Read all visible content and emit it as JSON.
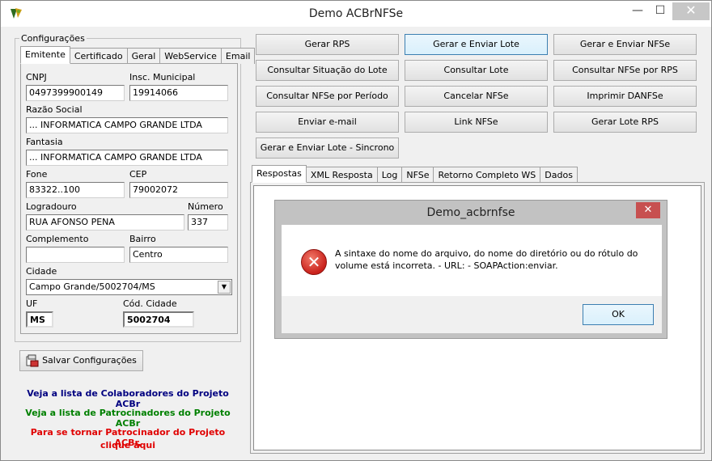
{
  "window": {
    "title": "Demo ACBrNFSe",
    "minimize": "—",
    "maximize": "☐",
    "close": "✕"
  },
  "config": {
    "group_label": "Configurações",
    "tabs": [
      "Emitente",
      "Certificado",
      "Geral",
      "WebService",
      "Email"
    ],
    "fields": {
      "cnpj_label": "CNPJ",
      "cnpj_value": "0497399900149",
      "im_label": "Insc. Municipal",
      "im_value": "19914066",
      "razao_label": "Razão Social",
      "razao_value": "... INFORMATICA CAMPO GRANDE LTDA",
      "fantasia_label": "Fantasia",
      "fantasia_value": "... INFORMATICA CAMPO GRANDE LTDA",
      "fone_label": "Fone",
      "fone_value": "83322..100",
      "cep_label": "CEP",
      "cep_value": "79002072",
      "logradouro_label": "Logradouro",
      "logradouro_value": "RUA AFONSO PENA",
      "numero_label": "Número",
      "numero_value": "337",
      "complemento_label": "Complemento",
      "complemento_value": "",
      "bairro_label": "Bairro",
      "bairro_value": "Centro",
      "cidade_label": "Cidade",
      "cidade_value": "Campo Grande/5002704/MS",
      "uf_label": "UF",
      "uf_value": "MS",
      "codcidade_label": "Cód. Cidade",
      "codcidade_value": "5002704"
    },
    "save_button": "Salvar Configurações"
  },
  "links": {
    "colaboradores": "Veja a lista de Colaboradores do Projeto ACBr",
    "patrocinadores": "Veja a lista de Patrocinadores do Projeto ACBr",
    "patrocinador_1": "Para se tornar Patrocinador do Projeto ACBr,",
    "patrocinador_2": "clique aqui"
  },
  "actions": {
    "gerar_rps": "Gerar RPS",
    "gerar_enviar_lote": "Gerar e Enviar Lote",
    "gerar_enviar_nfse": "Gerar e Enviar NFSe",
    "consultar_situacao": "Consultar Situação do Lote",
    "consultar_lote": "Consultar Lote",
    "consultar_nfse_rps": "Consultar NFSe por RPS",
    "consultar_nfse_periodo": "Consultar NFSe por Período",
    "cancelar_nfse": "Cancelar NFSe",
    "imprimir_danfse": "Imprimir DANFSe",
    "enviar_email": "Enviar e-mail",
    "link_nfse": "Link NFSe",
    "gerar_lote_rps": "Gerar Lote RPS",
    "gerar_enviar_sincrono": "Gerar e Enviar Lote - Sincrono"
  },
  "result_tabs": [
    "Respostas",
    "XML Resposta",
    "Log",
    "NFSe",
    "Retorno Completo WS",
    "Dados"
  ],
  "dialog": {
    "title": "Demo_acbrnfse",
    "close": "✕",
    "icon": "error-icon",
    "message_1": "A sintaxe do nome do arquivo, do nome do diretório ou do rótulo do",
    "message_2": "volume está incorreta. - URL: - SOAPAction:enviar.",
    "ok": "OK"
  },
  "colors": {
    "link_blue": "#000080",
    "link_green": "#008000",
    "link_red": "#e00000",
    "error_red": "#c9211b"
  }
}
